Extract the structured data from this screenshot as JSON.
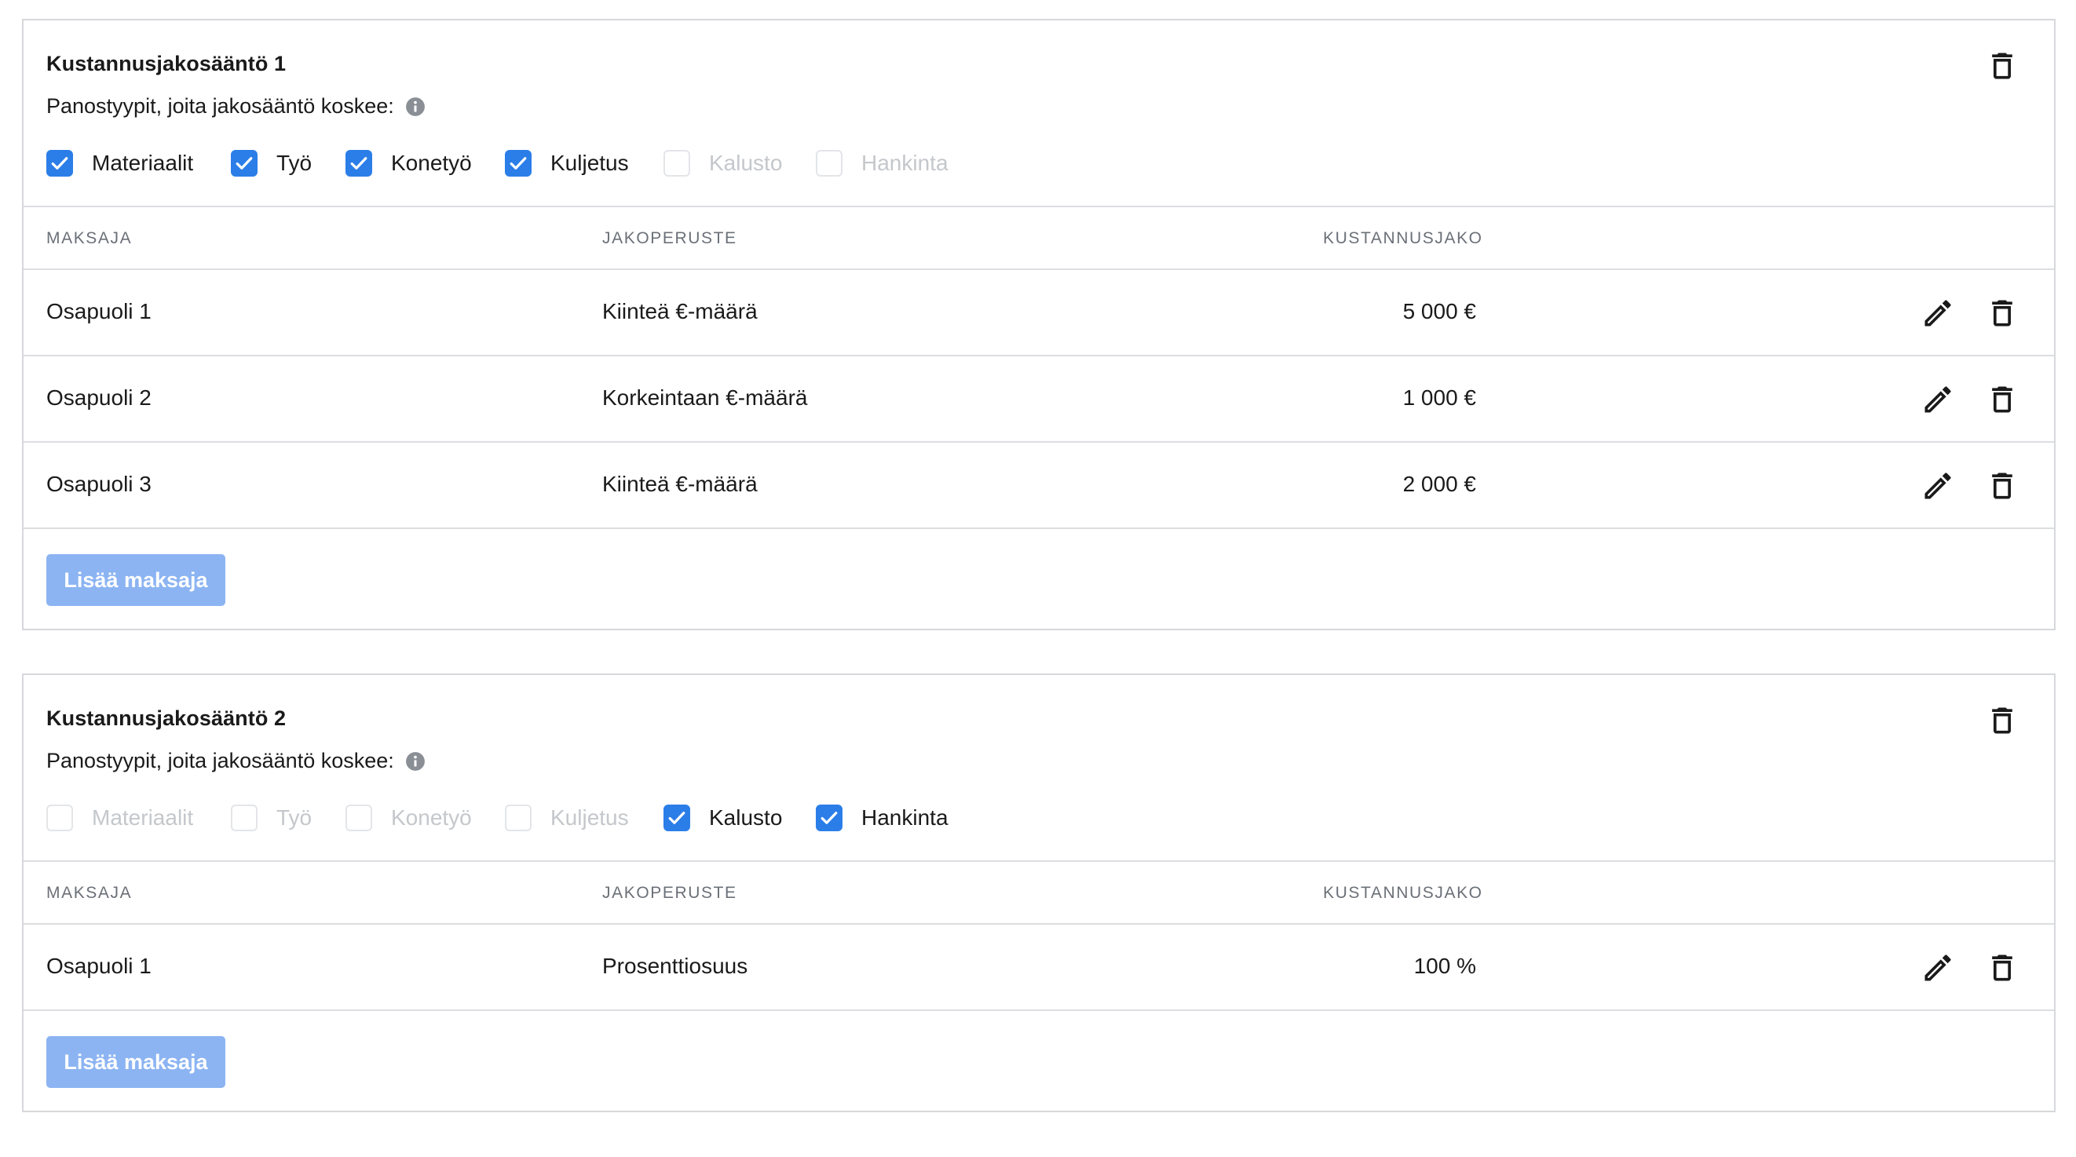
{
  "rules": [
    {
      "title": "Kustannusjakosääntö 1",
      "subtitle": "Panostyypit, joita jakosääntö koskee:",
      "cost_types": [
        {
          "label": "Materiaalit",
          "checked": true
        },
        {
          "label": "Työ",
          "checked": true
        },
        {
          "label": "Konetyö",
          "checked": true
        },
        {
          "label": "Kuljetus",
          "checked": true
        },
        {
          "label": "Kalusto",
          "checked": false
        },
        {
          "label": "Hankinta",
          "checked": false
        }
      ],
      "columns": {
        "payer": "MAKSAJA",
        "basis": "JAKOPERUSTE",
        "share": "KUSTANNUSJAKO"
      },
      "rows": [
        {
          "payer": "Osapuoli 1",
          "basis": "Kiinteä €-määrä",
          "share": "5 000 €"
        },
        {
          "payer": "Osapuoli 2",
          "basis": "Korkeintaan €-määrä",
          "share": "1 000 €"
        },
        {
          "payer": "Osapuoli 3",
          "basis": "Kiinteä €-määrä",
          "share": "2 000 €"
        }
      ],
      "add_payer_label": "Lisää maksaja"
    },
    {
      "title": "Kustannusjakosääntö 2",
      "subtitle": "Panostyypit, joita jakosääntö koskee:",
      "cost_types": [
        {
          "label": "Materiaalit",
          "checked": false
        },
        {
          "label": "Työ",
          "checked": false
        },
        {
          "label": "Konetyö",
          "checked": false
        },
        {
          "label": "Kuljetus",
          "checked": false
        },
        {
          "label": "Kalusto",
          "checked": true
        },
        {
          "label": "Hankinta",
          "checked": true
        }
      ],
      "columns": {
        "payer": "MAKSAJA",
        "basis": "JAKOPERUSTE",
        "share": "KUSTANNUSJAKO"
      },
      "rows": [
        {
          "payer": "Osapuoli 1",
          "basis": "Prosenttiosuus",
          "share": "100 %"
        }
      ],
      "add_payer_label": "Lisää maksaja"
    }
  ],
  "colors": {
    "accent": "#2b7ee8",
    "button": "#8cb4f2",
    "disabled_text": "#c4c7cb",
    "border": "#d6d8db"
  },
  "icons": {
    "info": "info-icon",
    "delete": "trash-icon",
    "edit": "pencil-icon",
    "check": "checkmark-icon"
  }
}
